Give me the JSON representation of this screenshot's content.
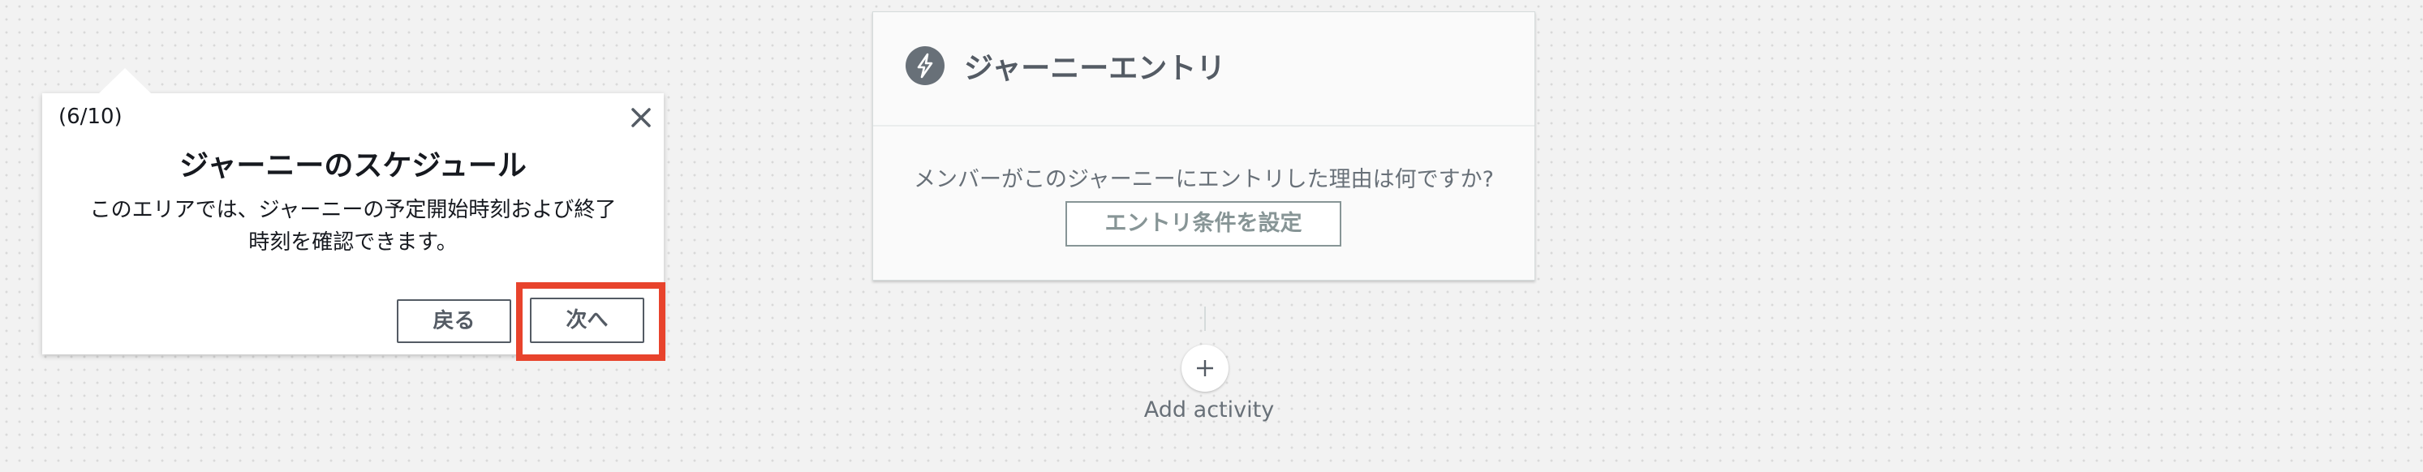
{
  "tour_popover": {
    "step_indicator": "(6/10)",
    "title": "ジャーニーのスケジュール",
    "body_line1": "このエリアでは、ジャーニーの予定開始時刻および終了",
    "body_line2": "時刻を確認できます。",
    "back_label": "戻る",
    "next_label": "次へ",
    "close_icon": "close-icon",
    "highlight_color": "#e8432c"
  },
  "journey_entry": {
    "title": "ジャーニーエントリ",
    "icon": "lightning-bolt-icon",
    "question": "メンバーがこのジャーニーにエントリした理由は何ですか?",
    "button_label": "エントリ条件を設定"
  },
  "add_activity": {
    "icon": "plus-icon",
    "label": "Add activity"
  }
}
